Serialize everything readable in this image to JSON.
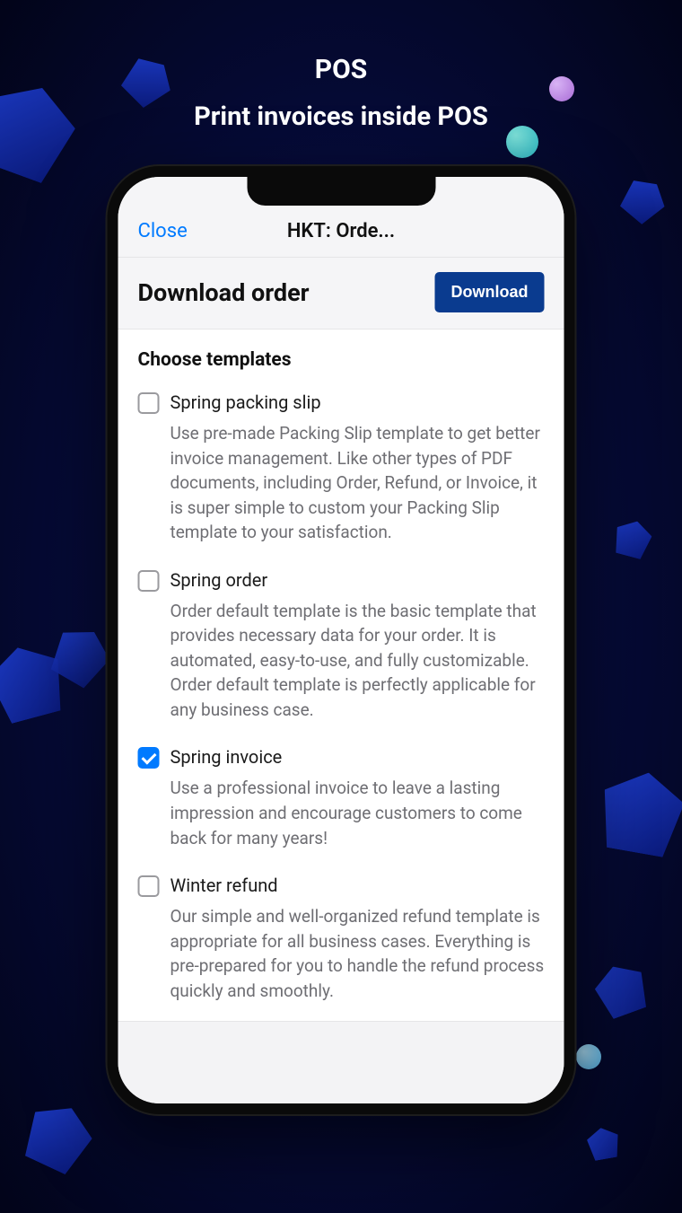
{
  "page": {
    "title": "POS",
    "subtitle": "Print invoices inside POS"
  },
  "header": {
    "close_label": "Close",
    "app_title": "HKT: Orde..."
  },
  "subheader": {
    "title": "Download order",
    "download_label": "Download"
  },
  "section": {
    "title": "Choose templates"
  },
  "templates": [
    {
      "title": "Spring packing slip",
      "desc": "Use pre-made Packing Slip template to get better invoice management. Like other types of PDF documents, including Order, Refund, or Invoice, it is super simple to custom your Packing Slip template to your satisfaction.",
      "checked": false
    },
    {
      "title": "Spring order",
      "desc": "Order default template is the basic template that provides necessary data for your order. It is automated, easy-to-use, and fully customizable. Order default template is perfectly applicable for any business case.",
      "checked": false
    },
    {
      "title": "Spring invoice",
      "desc": "Use a professional invoice to leave a lasting impression and encourage customers to come back for many years!",
      "checked": true
    },
    {
      "title": "Winter refund",
      "desc": "Our simple and well-organized refund template is appropriate for all business cases. Everything is pre-prepared for you to handle the refund process quickly and smoothly.",
      "checked": false
    }
  ]
}
